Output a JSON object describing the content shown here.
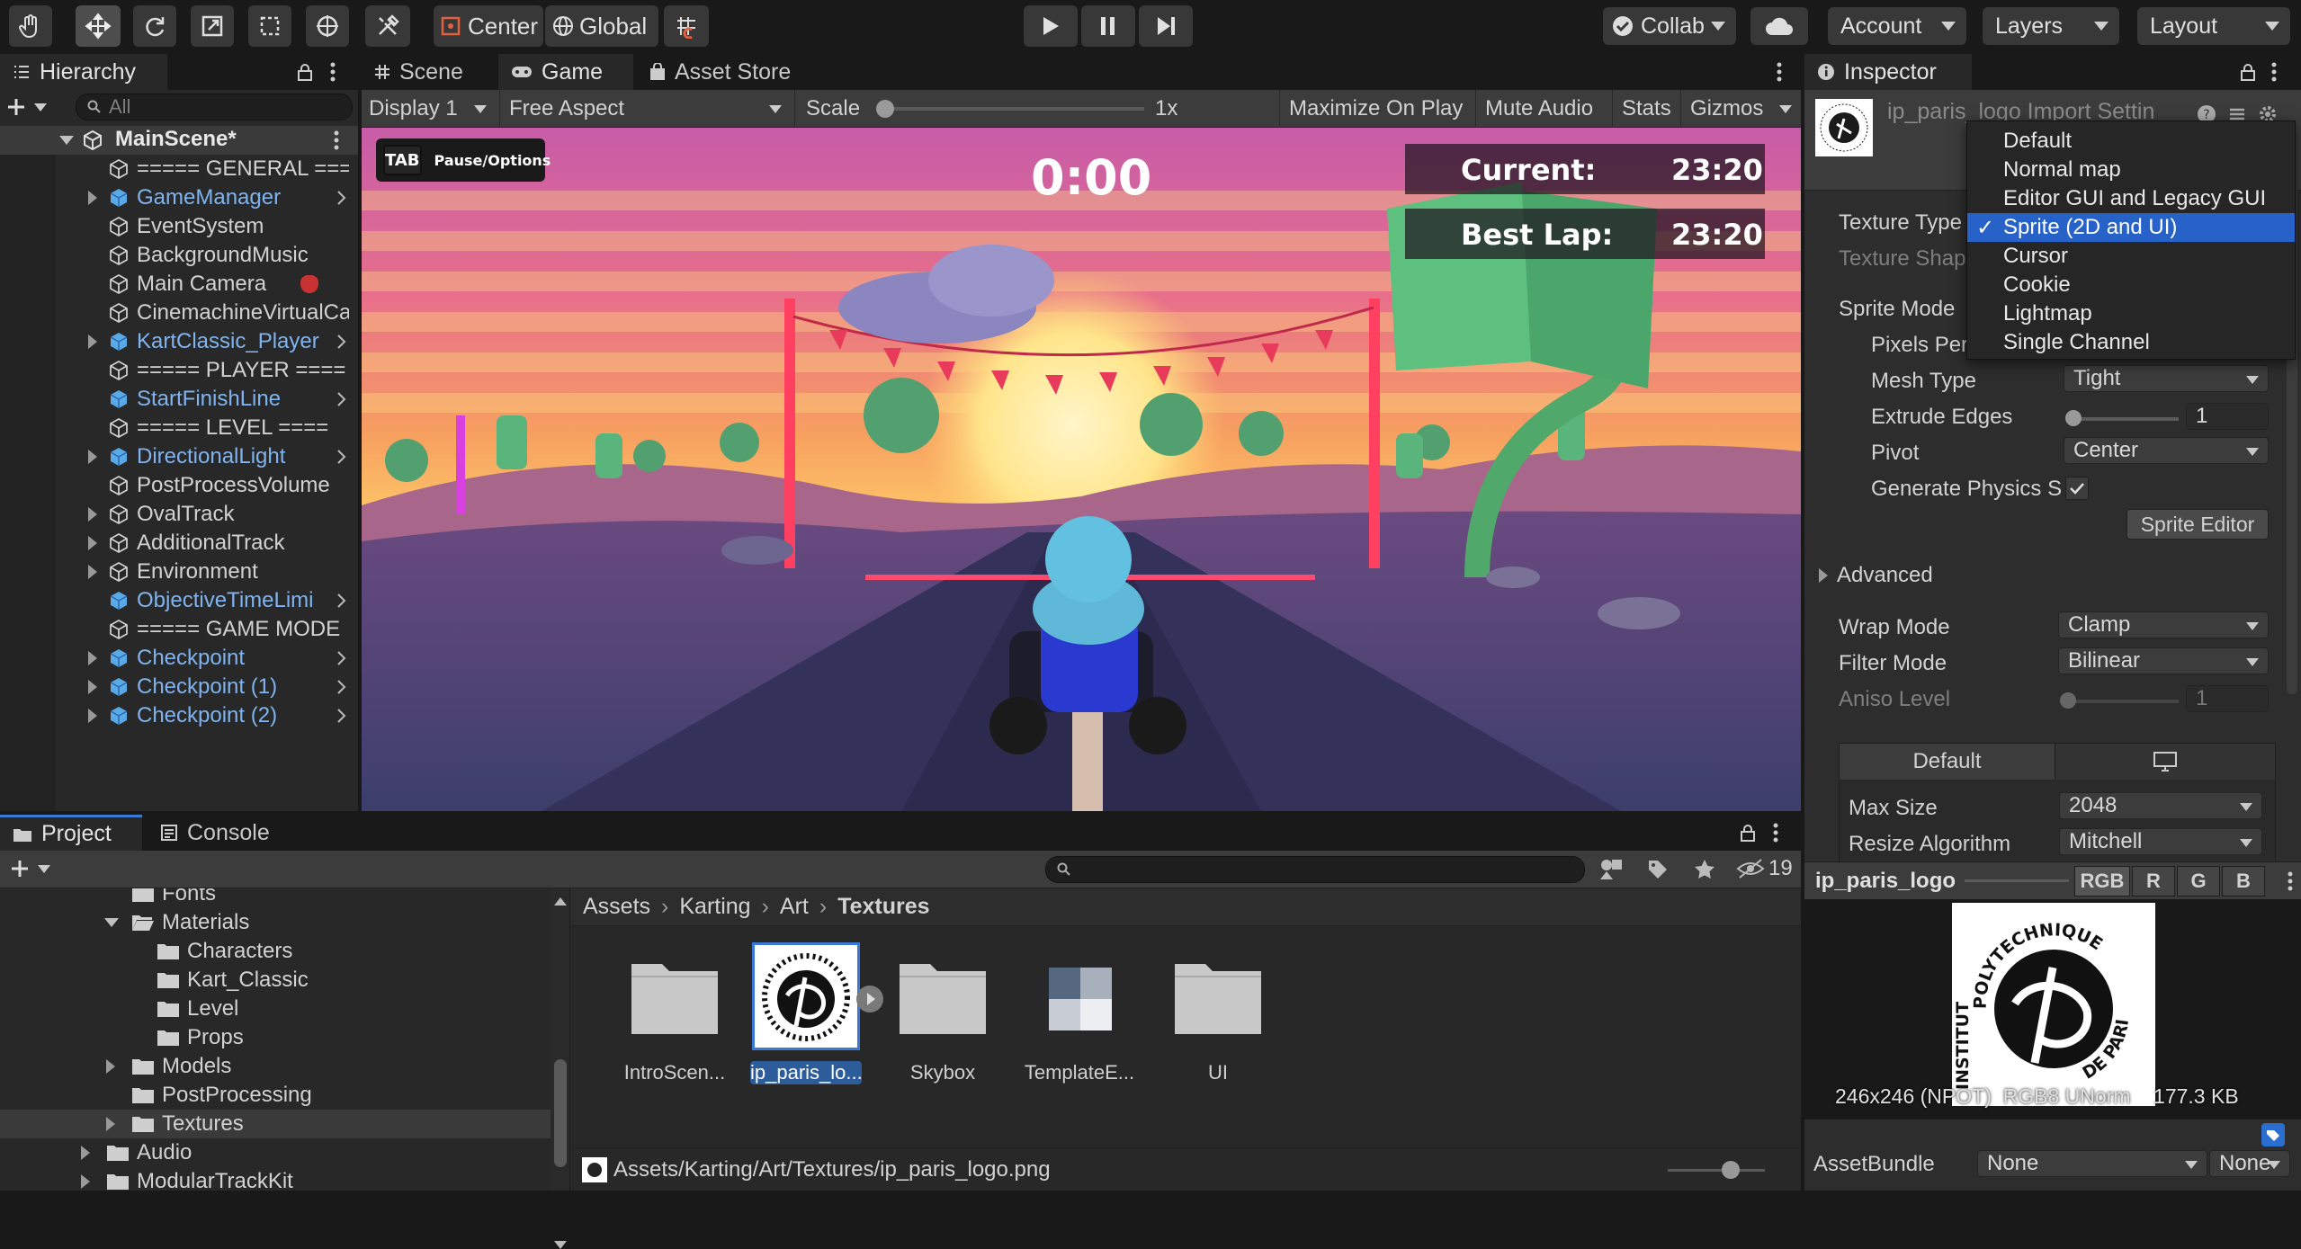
{
  "toolbar": {
    "pivot": "Center",
    "space": "Global",
    "collab": "Collab",
    "account": "Account",
    "layers": "Layers",
    "layout": "Layout"
  },
  "hierarchy": {
    "tab": "Hierarchy",
    "search_placeholder": "All",
    "scene": "MainScene*",
    "items": [
      {
        "label": "===== GENERAL ====",
        "blue": false,
        "arrow": false,
        "fold": false
      },
      {
        "label": "GameManager",
        "blue": true,
        "arrow": true,
        "fold": true
      },
      {
        "label": "EventSystem",
        "blue": false,
        "arrow": false,
        "fold": false
      },
      {
        "label": "BackgroundMusic",
        "blue": false,
        "arrow": false,
        "fold": false
      },
      {
        "label": "Main Camera",
        "blue": false,
        "arrow": false,
        "fold": false
      },
      {
        "label": "CinemachineVirtualCa",
        "blue": false,
        "arrow": false,
        "fold": false
      },
      {
        "label": "KartClassic_Player",
        "blue": true,
        "arrow": true,
        "fold": true
      },
      {
        "label": "===== PLAYER ====",
        "blue": false,
        "arrow": false,
        "fold": false
      },
      {
        "label": "StartFinishLine",
        "blue": true,
        "arrow": true,
        "fold": false
      },
      {
        "label": "===== LEVEL ====",
        "blue": false,
        "arrow": false,
        "fold": false
      },
      {
        "label": "DirectionalLight",
        "blue": true,
        "arrow": true,
        "fold": true
      },
      {
        "label": "PostProcessVolume",
        "blue": false,
        "arrow": false,
        "fold": false
      },
      {
        "label": "OvalTrack",
        "blue": false,
        "arrow": false,
        "fold": true
      },
      {
        "label": "AdditionalTrack",
        "blue": false,
        "arrow": false,
        "fold": true
      },
      {
        "label": "Environment",
        "blue": false,
        "arrow": false,
        "fold": true
      },
      {
        "label": "ObjectiveTimeLimi",
        "blue": true,
        "arrow": true,
        "fold": false
      },
      {
        "label": "===== GAME MODE",
        "blue": false,
        "arrow": false,
        "fold": false
      },
      {
        "label": "Checkpoint",
        "blue": true,
        "arrow": true,
        "fold": true
      },
      {
        "label": "Checkpoint (1)",
        "blue": true,
        "arrow": true,
        "fold": true
      },
      {
        "label": "Checkpoint (2)",
        "blue": true,
        "arrow": true,
        "fold": true
      }
    ]
  },
  "game": {
    "tabs": [
      "Scene",
      "Game",
      "Asset Store"
    ],
    "display": "Display 1",
    "aspect": "Free Aspect",
    "scale_label": "Scale",
    "scale_value": "1x",
    "maximize": "Maximize On Play",
    "mute": "Mute Audio",
    "stats": "Stats",
    "gizmos": "Gizmos",
    "hud": {
      "tab_key": "TAB",
      "tab_text": "Pause/Options",
      "timer": "0:00",
      "current_label": "Current:",
      "current_time": "23:20",
      "best_label": "Best Lap:",
      "best_time": "23:20"
    }
  },
  "inspector": {
    "tab": "Inspector",
    "title": "ip_paris_logo Import Settin",
    "dropdown_options": [
      "Default",
      "Normal map",
      "Editor GUI and Legacy GUI",
      "Sprite (2D and UI)",
      "Cursor",
      "Cookie",
      "Lightmap",
      "Single Channel"
    ],
    "dropdown_selected": "Sprite (2D and UI)",
    "texture_type": "Texture Type",
    "texture_shape": "Texture Shap",
    "sprite_mode": "Sprite Mode",
    "pixels_per": "Pixels Per",
    "mesh_type": "Mesh Type",
    "mesh_type_val": "Tight",
    "extrude": "Extrude Edges",
    "extrude_val": "1",
    "pivot": "Pivot",
    "pivot_val": "Center",
    "gen_physics": "Generate Physics S",
    "sprite_editor": "Sprite Editor",
    "advanced": "Advanced",
    "wrap": "Wrap Mode",
    "wrap_val": "Clamp",
    "filter": "Filter Mode",
    "filter_val": "Bilinear",
    "aniso": "Aniso Level",
    "aniso_val": "1",
    "platform_default": "Default",
    "max_size": "Max Size",
    "max_size_val": "2048",
    "resize": "Resize Algorithm",
    "resize_val": "Mitchell",
    "preview_name": "ip_paris_logo",
    "channels": [
      "RGB",
      "R",
      "G",
      "B"
    ],
    "preview_info": "246x246 (NPOT)  RGB8 UNorm    177.3 KB",
    "assetbundle": "AssetBundle",
    "assetbundle_val": "None",
    "assetbundle_variant": "None"
  },
  "logo_text": {
    "top": "POLYTECHNIQUE",
    "left": "INSTITUT",
    "bottom": "DE PARIS"
  },
  "project": {
    "tabs": [
      "Project",
      "Console"
    ],
    "count": "19",
    "tree": [
      {
        "label": "Fonts",
        "indent": 1,
        "fold": "none",
        "partial": true
      },
      {
        "label": "Materials",
        "indent": 1,
        "fold": "open"
      },
      {
        "label": "Characters",
        "indent": 2,
        "fold": "none"
      },
      {
        "label": "Kart_Classic",
        "indent": 2,
        "fold": "none"
      },
      {
        "label": "Level",
        "indent": 2,
        "fold": "none"
      },
      {
        "label": "Props",
        "indent": 2,
        "fold": "none"
      },
      {
        "label": "Models",
        "indent": 1,
        "fold": "closed"
      },
      {
        "label": "PostProcessing",
        "indent": 1,
        "fold": "none"
      },
      {
        "label": "Textures",
        "indent": 1,
        "fold": "closed",
        "selected": true
      },
      {
        "label": "Audio",
        "indent": 0,
        "fold": "closed"
      },
      {
        "label": "ModularTrackKit",
        "indent": 0,
        "fold": "closed"
      }
    ],
    "breadcrumb": [
      "Assets",
      "Karting",
      "Art",
      "Textures"
    ],
    "assets": [
      {
        "name": "IntroScen...",
        "kind": "folder"
      },
      {
        "name": "ip_paris_lo...",
        "kind": "logo"
      },
      {
        "name": "Skybox",
        "kind": "folder"
      },
      {
        "name": "TemplateE...",
        "kind": "texture"
      },
      {
        "name": "UI",
        "kind": "folder"
      }
    ],
    "path": "Assets/Karting/Art/Textures/ip_paris_logo.png"
  }
}
